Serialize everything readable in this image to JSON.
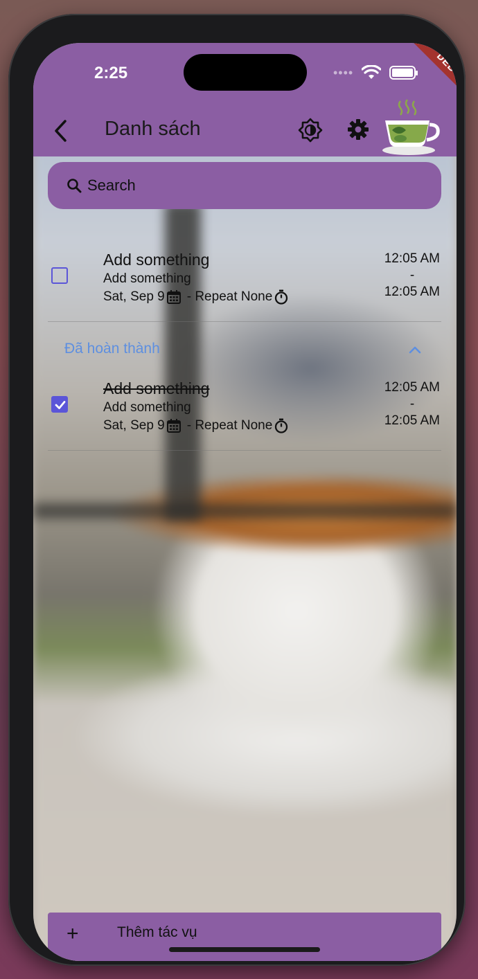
{
  "status": {
    "time": "2:25",
    "debug_label": "DEBUG"
  },
  "header": {
    "title": "Danh sách"
  },
  "search": {
    "placeholder": "Search"
  },
  "tasks": [
    {
      "title": "Add something",
      "subtitle": "Add something",
      "date": "Sat, Sep 9",
      "repeat": "- Repeat None",
      "start": "12:05 AM",
      "sep": "-",
      "end": "12:05 AM",
      "completed": false
    }
  ],
  "completed_section": {
    "label": "Đã hoàn thành",
    "tasks": [
      {
        "title": "Add something",
        "subtitle": "Add something",
        "date": "Sat, Sep 9",
        "repeat": "- Repeat None",
        "start": "12:05 AM",
        "sep": "-",
        "end": "12:05 AM",
        "completed": true
      }
    ]
  },
  "footer": {
    "add_label": "Thêm tác vụ",
    "plus": "+"
  },
  "colors": {
    "accent": "#8b5ea3",
    "checkbox": "#5b55d8",
    "section": "#5e8fe0"
  }
}
